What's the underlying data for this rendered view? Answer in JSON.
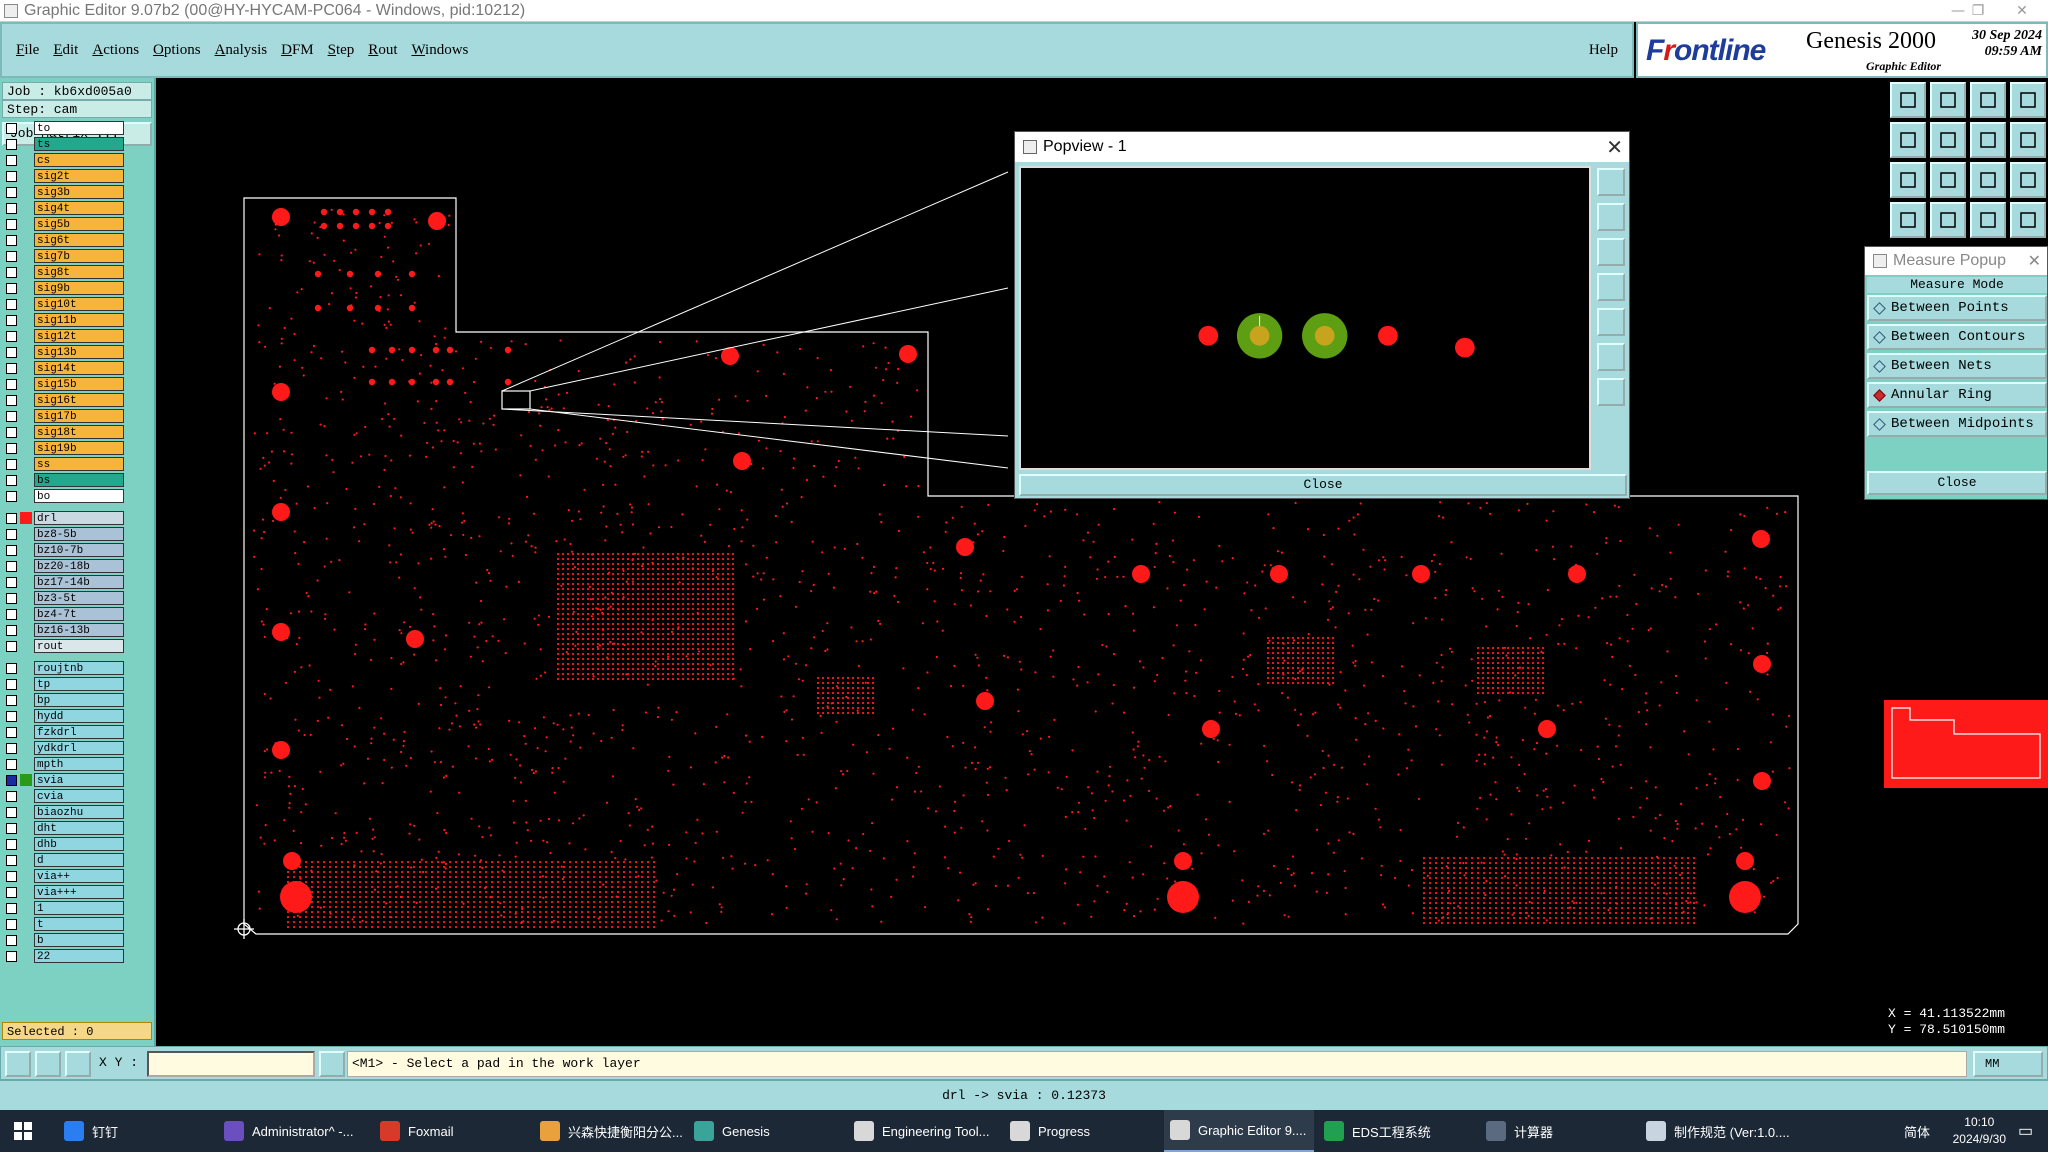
{
  "window": {
    "title": "Graphic Editor 9.07b2 (00@HY-HYCAM-PC064 - Windows, pid:10212)"
  },
  "menu": [
    "File",
    "Edit",
    "Actions",
    "Options",
    "Analysis",
    "DFM",
    "Step",
    "Rout",
    "Windows"
  ],
  "help": "Help",
  "brand": {
    "logo_a": "F",
    "logo_red": "r",
    "logo_b": "ontline",
    "product": "Genesis 2000",
    "subtitle": "Graphic Editor",
    "date": "30 Sep 2024",
    "time": "09:59 AM"
  },
  "job": {
    "job": "Job : kb6xd005a0",
    "step": "Step: cam",
    "matrix_button": "Job Matrix ..."
  },
  "layers": [
    {
      "name": "to",
      "color": "#ffffff"
    },
    {
      "name": "ts",
      "color": "#22a88c"
    },
    {
      "name": "cs",
      "color": "#f7b43a"
    },
    {
      "name": "sig2t",
      "color": "#f7b43a"
    },
    {
      "name": "sig3b",
      "color": "#f7b43a"
    },
    {
      "name": "sig4t",
      "color": "#f7b43a"
    },
    {
      "name": "sig5b",
      "color": "#f7b43a"
    },
    {
      "name": "sig6t",
      "color": "#f7b43a"
    },
    {
      "name": "sig7b",
      "color": "#f7b43a"
    },
    {
      "name": "sig8t",
      "color": "#f7b43a"
    },
    {
      "name": "sig9b",
      "color": "#f7b43a"
    },
    {
      "name": "sig10t",
      "color": "#f7b43a"
    },
    {
      "name": "sig11b",
      "color": "#f7b43a"
    },
    {
      "name": "sig12t",
      "color": "#f7b43a"
    },
    {
      "name": "sig13b",
      "color": "#f7b43a"
    },
    {
      "name": "sig14t",
      "color": "#f7b43a"
    },
    {
      "name": "sig15b",
      "color": "#f7b43a"
    },
    {
      "name": "sig16t",
      "color": "#f7b43a"
    },
    {
      "name": "sig17b",
      "color": "#f7b43a"
    },
    {
      "name": "sig18t",
      "color": "#f7b43a"
    },
    {
      "name": "sig19b",
      "color": "#f7b43a"
    },
    {
      "name": "ss",
      "color": "#f7b43a"
    },
    {
      "name": "bs",
      "color": "#22a88c"
    },
    {
      "name": "bo",
      "color": "#ffffff"
    },
    {
      "name": "drl",
      "color": "#c9d9e2",
      "swatch": "#ff1a1a"
    },
    {
      "name": "bz8-5b",
      "color": "#a9c2d6"
    },
    {
      "name": "bz10-7b",
      "color": "#a9c2d6"
    },
    {
      "name": "bz20-18b",
      "color": "#a9c2d6"
    },
    {
      "name": "bz17-14b",
      "color": "#a9c2d6"
    },
    {
      "name": "bz3-5t",
      "color": "#a9c2d6"
    },
    {
      "name": "bz4-7t",
      "color": "#a9c2d6"
    },
    {
      "name": "bz16-13b",
      "color": "#a9c2d6"
    },
    {
      "name": "rout",
      "color": "#dbe6ea"
    },
    {
      "name": "roujtnb",
      "color": "#8fd6e0"
    },
    {
      "name": "tp",
      "color": "#8fd6e0"
    },
    {
      "name": "bp",
      "color": "#8fd6e0"
    },
    {
      "name": "hydd",
      "color": "#8fd6e0"
    },
    {
      "name": "fzkdrl",
      "color": "#8fd6e0"
    },
    {
      "name": "ydkdrl",
      "color": "#8fd6e0"
    },
    {
      "name": "mpth",
      "color": "#8fd6e0"
    },
    {
      "name": "svia",
      "color": "#8fd6e0",
      "swatch": "#2a9a1a",
      "work": true
    },
    {
      "name": "cvia",
      "color": "#8fd6e0"
    },
    {
      "name": "biaozhu",
      "color": "#8fd6e0"
    },
    {
      "name": "dht",
      "color": "#8fd6e0"
    },
    {
      "name": "dhb",
      "color": "#8fd6e0"
    },
    {
      "name": "d",
      "color": "#8fd6e0"
    },
    {
      "name": "via++",
      "color": "#8fd6e0"
    },
    {
      "name": "via+++",
      "color": "#8fd6e0"
    },
    {
      "name": "1",
      "color": "#8fd6e0"
    },
    {
      "name": "t",
      "color": "#8fd6e0"
    },
    {
      "name": "b",
      "color": "#8fd6e0"
    },
    {
      "name": "22",
      "color": "#8fd6e0"
    }
  ],
  "selected": "Selected : 0",
  "popview": {
    "title": "Popview - 1",
    "close": "Close"
  },
  "measure": {
    "title": "Measure Popup",
    "mode_label": "Measure Mode",
    "options": [
      "Between Points",
      "Between Contours",
      "Between Nets",
      "Annular Ring",
      "Between Midpoints"
    ],
    "selected_option": "Annular Ring",
    "close": "Close"
  },
  "coords": {
    "x": "X = 41.113522mm",
    "y": "Y = 78.510150mm"
  },
  "command": {
    "xy_label": "X Y :",
    "xy_value": "",
    "prompt": "<M1> - Select a pad in the work layer",
    "units": "MM"
  },
  "status": "drl -> svia : 0.12373",
  "taskbar": [
    {
      "label": "钉钉",
      "color": "#2a7ef0"
    },
    {
      "label": "Administrator^ -...",
      "color": "#6b4fbf"
    },
    {
      "label": "Foxmail",
      "color": "#d83a2a"
    },
    {
      "label": "兴森快捷衡阳分公...",
      "color": "#e9a23b"
    },
    {
      "label": "Genesis",
      "color": "#3aa39a"
    },
    {
      "label": "Engineering Tool...",
      "color": "#d8d8d8"
    },
    {
      "label": "Progress",
      "color": "#d8d8d8"
    },
    {
      "label": "Graphic Editor 9....",
      "color": "#d8d8d8",
      "active": true
    },
    {
      "label": "EDS工程系统",
      "color": "#20a050"
    },
    {
      "label": "计算器",
      "color": "#5a6a80"
    },
    {
      "label": "制作规范 (Ver:1.0....",
      "color": "#c8d4e0"
    }
  ],
  "tray": {
    "ime": "简体",
    "time": "10:10",
    "date": "2024/9/30"
  },
  "colors": {
    "panel": "#a6dadd",
    "pad": "#ff1a1a",
    "ring": "#5e9e12",
    "ring_inner": "#c8a41e",
    "outline": "#ffffff"
  }
}
